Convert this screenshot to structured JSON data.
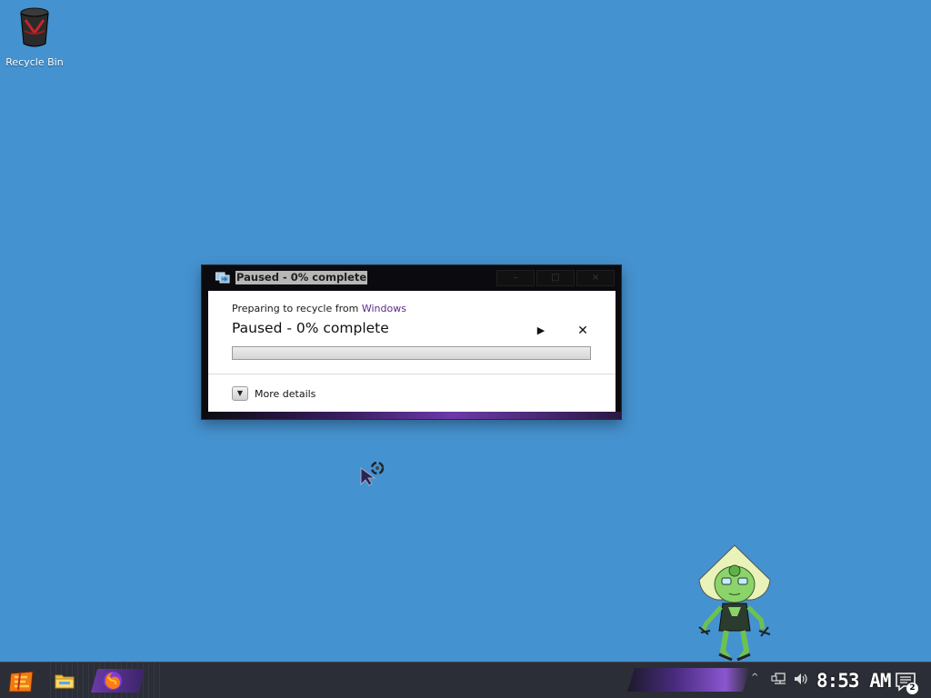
{
  "desktop": {
    "background_color": "#4592d0",
    "icons": [
      {
        "label": "Recycle Bin",
        "icon": "recycle-bin-icon"
      }
    ]
  },
  "dialog": {
    "title": "Paused - 0% complete",
    "window_buttons": {
      "minimize": "–",
      "maximize": "□",
      "close": "×"
    },
    "subtitle_prefix": "Preparing to recycle from ",
    "subtitle_location": "Windows",
    "status": "Paused - 0% complete",
    "progress": 0,
    "resume_symbol": "▶",
    "cancel_symbol": "✕",
    "more_details_label": "More details",
    "accent_color": "#6b3aa8"
  },
  "taskbar": {
    "background_color": "#2b2e36",
    "apps": [
      "start-menu",
      "file-explorer",
      "firefox"
    ],
    "tray_chevron": "^",
    "clock": "8:53 AM",
    "notifications_count": "2"
  }
}
